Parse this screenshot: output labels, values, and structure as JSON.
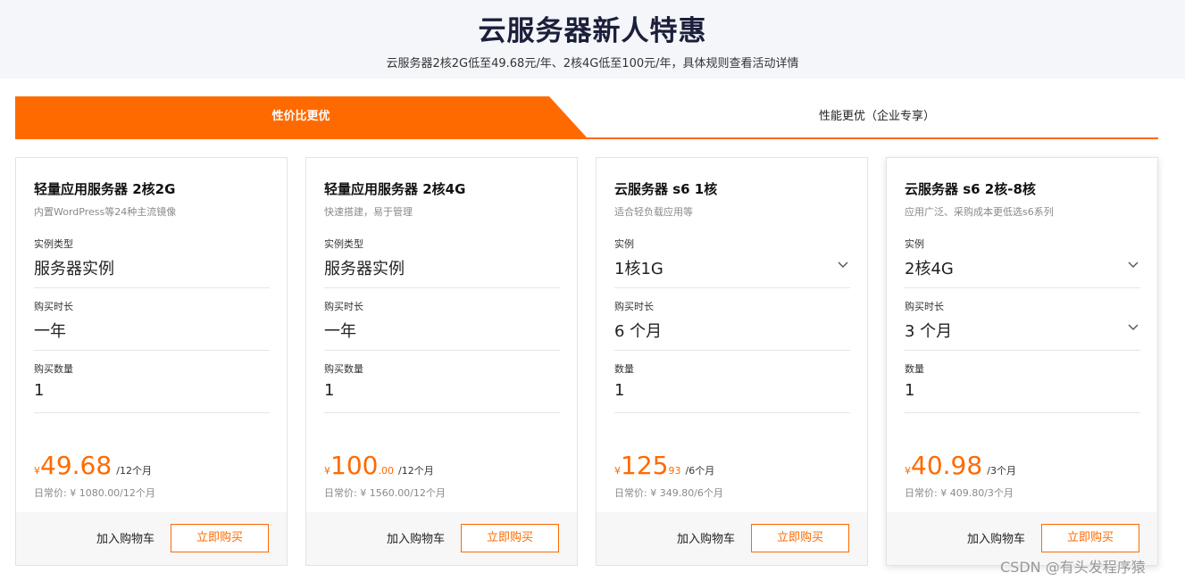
{
  "banner": {
    "title": "云服务器新人特惠",
    "subtitle": "云服务器2核2G低至49.68元/年、2核4G低至100元/年，具体规则查看活动详情"
  },
  "tabs": {
    "active": "性价比更优",
    "inactive": "性能更优（企业专享）"
  },
  "colors": {
    "accent": "#ff6a00",
    "banner_bg": "#f5f6fa",
    "title": "#1b1f3a"
  },
  "cards": [
    {
      "title": "轻量应用服务器 2核2G",
      "desc": "内置WordPress等24种主流镜像",
      "f1_label": "实例类型",
      "f1_value": "服务器实例",
      "f2_label": "购买时长",
      "f2_value": "一年",
      "f3_label": "购买数量",
      "f3_value": "1",
      "currency": "¥",
      "price_int": "49.68",
      "price_dec": "",
      "price_unit": "/12个月",
      "normal_price": "日常价: ¥ 1080.00/12个月",
      "cart": "加入购物车",
      "buy": "立即购买"
    },
    {
      "title": "轻量应用服务器 2核4G",
      "desc": "快速搭建，易于管理",
      "f1_label": "实例类型",
      "f1_value": "服务器实例",
      "f2_label": "购买时长",
      "f2_value": "一年",
      "f3_label": "购买数量",
      "f3_value": "1",
      "currency": "¥",
      "price_int": "100",
      "price_dec": ".00",
      "price_unit": "/12个月",
      "normal_price": "日常价: ¥ 1560.00/12个月",
      "cart": "加入购物车",
      "buy": "立即购买"
    },
    {
      "title": "云服务器 s6 1核",
      "desc": "适合轻负载应用等",
      "f1_label": "实例",
      "f1_value": "1核1G",
      "f2_label": "购买时长",
      "f2_value": "6 个月",
      "f3_label": "数量",
      "f3_value": "1",
      "currency": "¥",
      "price_int": "125",
      "price_dec": "93",
      "price_unit": "/6个月",
      "normal_price": "日常价: ¥ 349.80/6个月",
      "cart": "加入购物车",
      "buy": "立即购买"
    },
    {
      "title": "云服务器 s6 2核-8核",
      "desc": "应用广泛、采购成本更低选s6系列",
      "f1_label": "实例",
      "f1_value": "2核4G",
      "f2_label": "购买时长",
      "f2_value": "3 个月",
      "f3_label": "数量",
      "f3_value": "1",
      "currency": "¥",
      "price_int": "40.98",
      "price_dec": "",
      "price_unit": "/3个月",
      "normal_price": "日常价: ¥ 409.80/3个月",
      "cart": "加入购物车",
      "buy": "立即购买"
    }
  ],
  "icons": {
    "dropdown": "chevron-down-icon"
  },
  "watermark": "CSDN @有头发程序猿"
}
